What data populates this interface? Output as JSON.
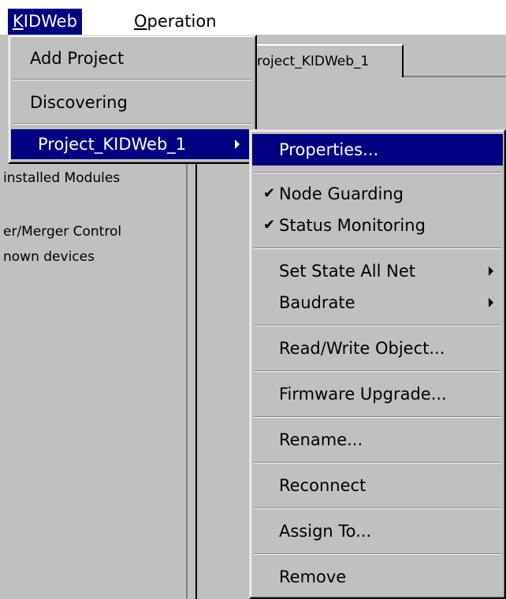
{
  "menubar": {
    "items": [
      {
        "label": "KIDWeb",
        "accel": "K",
        "rest": "IDWeb"
      },
      {
        "label": "Operation",
        "accel": "O",
        "rest": "peration"
      }
    ]
  },
  "tab": {
    "label": "roject_KIDWeb_1"
  },
  "tree": {
    "lines": [
      "installed Modules",
      "er/Merger Control",
      "nown devices"
    ]
  },
  "kidweb_menu": {
    "items": [
      "Add Project",
      "Discovering",
      "Project_KIDWeb_1"
    ]
  },
  "project_menu": {
    "properties": "Properties...",
    "node_guarding": "Node Guarding",
    "status_monitoring": "Status Monitoring",
    "set_state_all_net": "Set State All Net",
    "baudrate": "Baudrate",
    "read_write_object": "Read/Write Object...",
    "firmware_upgrade": "Firmware Upgrade...",
    "rename": "Rename...",
    "reconnect": "Reconnect",
    "assign_to": "Assign To...",
    "remove": "Remove",
    "check_glyph": "✔"
  }
}
